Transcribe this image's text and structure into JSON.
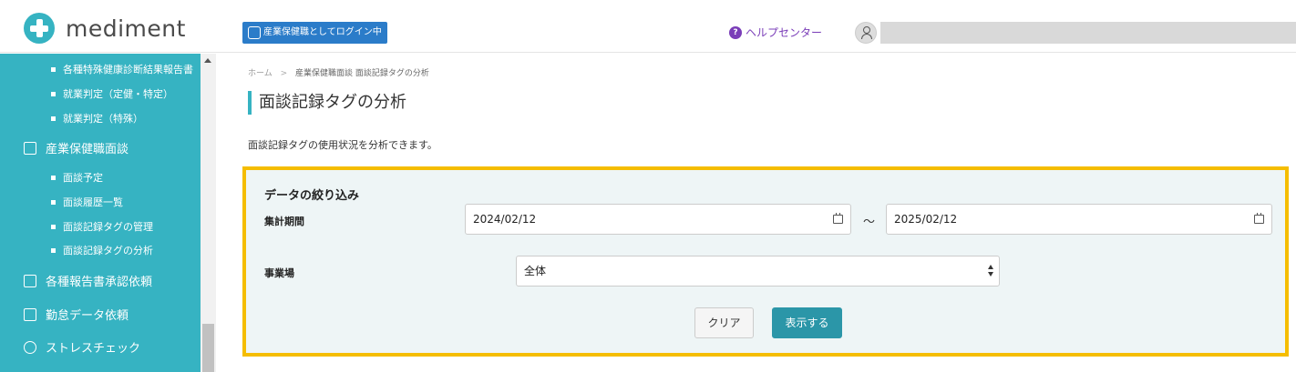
{
  "app": {
    "logo_text": "mediment",
    "login_badge": "産業保健職としてログイン中",
    "help_label": "ヘルプセンター",
    "help_glyph": "?"
  },
  "sidebar": {
    "items": [
      {
        "type": "sub",
        "label": "各種特殊健康診断結果報告書"
      },
      {
        "type": "sub",
        "label": "就業判定（定健・特定）"
      },
      {
        "type": "sub",
        "label": "就業判定（特殊）"
      },
      {
        "type": "main",
        "icon": "people-icon",
        "label": "産業保健職面談"
      },
      {
        "type": "sub",
        "label": "面談予定"
      },
      {
        "type": "sub",
        "label": "面談履歴一覧"
      },
      {
        "type": "sub",
        "label": "面談記録タグの管理"
      },
      {
        "type": "sub",
        "label": "面談記録タグの分析"
      },
      {
        "type": "main",
        "icon": "document-check-icon",
        "label": "各種報告書承認依頼"
      },
      {
        "type": "main",
        "icon": "clock-calendar-icon",
        "label": "勤怠データ依頼"
      },
      {
        "type": "main",
        "icon": "heart-icon",
        "label": "ストレスチェック"
      }
    ]
  },
  "breadcrumb": {
    "home": "ホーム",
    "separator": ">",
    "current": "産業保健職面談 面談記録タグの分析"
  },
  "page": {
    "title": "面談記録タグの分析",
    "description": "面談記録タグの使用状況を分析できます。"
  },
  "filter": {
    "title": "データの絞り込み",
    "period_label": "集計期間",
    "start_date": "2024/02/12",
    "range_separator": "～",
    "end_date": "2025/02/12",
    "site_label": "事業場",
    "site_value": "全体",
    "clear_button": "クリア",
    "show_button": "表示する"
  },
  "colors": {
    "sidebar": "#36b3c2",
    "highlight_border": "#f5bd00",
    "primary_button": "#2b96a8",
    "login_badge": "#2b7cc9",
    "help_link": "#7a3db8"
  }
}
